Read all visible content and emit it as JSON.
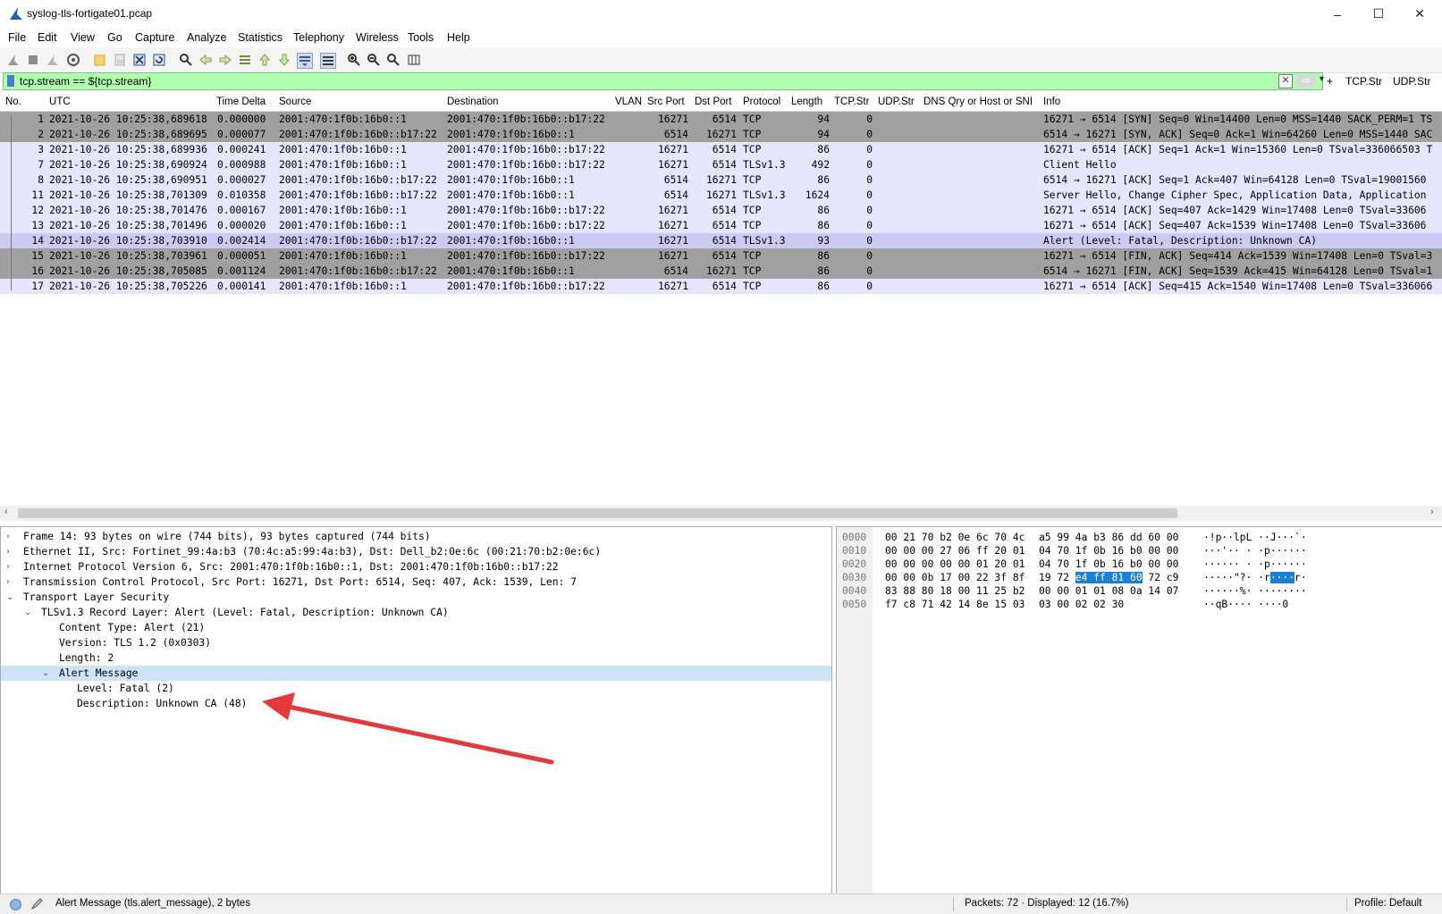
{
  "window": {
    "title": "syslog-tls-fortigate01.pcap",
    "controls": [
      "–",
      "☐",
      "✕"
    ]
  },
  "menu": [
    "File",
    "Edit",
    "View",
    "Go",
    "Capture",
    "Analyze",
    "Statistics",
    "Telephony",
    "Wireless",
    "Tools",
    "Help"
  ],
  "filter": {
    "value": "tcp.stream == ${tcp.stream}",
    "buttons": [
      "+",
      "TCP.Str",
      "UDP.Str"
    ]
  },
  "columns": [
    "No.",
    "UTC",
    "Time Delta",
    "Source",
    "Destination",
    "VLAN",
    "Src Port",
    "Dst Port",
    "Protocol",
    "Length",
    "TCP.Str",
    "UDP.Str",
    "DNS Qry or Host or SNI",
    "Info"
  ],
  "packets": [
    {
      "no": "1",
      "utc": "2021-10-26 10:25:38,689618",
      "delta": "0.000000",
      "src": "2001:470:1f0b:16b0::1",
      "dst": "2001:470:1f0b:16b0::b17:22",
      "sport": "16271",
      "dport": "6514",
      "proto": "TCP",
      "len": "94",
      "tcpstr": "0",
      "info": "16271 → 6514 [SYN] Seq=0 Win=14400 Len=0 MSS=1440 SACK_PERM=1 TS",
      "style": "dark"
    },
    {
      "no": "2",
      "utc": "2021-10-26 10:25:38,689695",
      "delta": "0.000077",
      "src": "2001:470:1f0b:16b0::b17:22",
      "dst": "2001:470:1f0b:16b0::1",
      "sport": "6514",
      "dport": "16271",
      "proto": "TCP",
      "len": "94",
      "tcpstr": "0",
      "info": "6514 → 16271 [SYN, ACK] Seq=0 Ack=1 Win=64260 Len=0 MSS=1440 SAC",
      "style": "dark"
    },
    {
      "no": "3",
      "utc": "2021-10-26 10:25:38,689936",
      "delta": "0.000241",
      "src": "2001:470:1f0b:16b0::1",
      "dst": "2001:470:1f0b:16b0::b17:22",
      "sport": "16271",
      "dport": "6514",
      "proto": "TCP",
      "len": "86",
      "tcpstr": "0",
      "info": "16271 → 6514 [ACK] Seq=1 Ack=1 Win=15360 Len=0 TSval=336066503 T",
      "style": "light"
    },
    {
      "no": "7",
      "utc": "2021-10-26 10:25:38,690924",
      "delta": "0.000988",
      "src": "2001:470:1f0b:16b0::1",
      "dst": "2001:470:1f0b:16b0::b17:22",
      "sport": "16271",
      "dport": "6514",
      "proto": "TLSv1.3",
      "len": "492",
      "tcpstr": "0",
      "info": "Client Hello",
      "style": "light"
    },
    {
      "no": "8",
      "utc": "2021-10-26 10:25:38,690951",
      "delta": "0.000027",
      "src": "2001:470:1f0b:16b0::b17:22",
      "dst": "2001:470:1f0b:16b0::1",
      "sport": "6514",
      "dport": "16271",
      "proto": "TCP",
      "len": "86",
      "tcpstr": "0",
      "info": "6514 → 16271 [ACK] Seq=1 Ack=407 Win=64128 Len=0 TSval=19001560",
      "style": "light"
    },
    {
      "no": "11",
      "utc": "2021-10-26 10:25:38,701309",
      "delta": "0.010358",
      "src": "2001:470:1f0b:16b0::b17:22",
      "dst": "2001:470:1f0b:16b0::1",
      "sport": "6514",
      "dport": "16271",
      "proto": "TLSv1.3",
      "len": "1624",
      "tcpstr": "0",
      "info": "Server Hello, Change Cipher Spec, Application Data, Application",
      "style": "light"
    },
    {
      "no": "12",
      "utc": "2021-10-26 10:25:38,701476",
      "delta": "0.000167",
      "src": "2001:470:1f0b:16b0::1",
      "dst": "2001:470:1f0b:16b0::b17:22",
      "sport": "16271",
      "dport": "6514",
      "proto": "TCP",
      "len": "86",
      "tcpstr": "0",
      "info": "16271 → 6514 [ACK] Seq=407 Ack=1429 Win=17408 Len=0 TSval=33606",
      "style": "light"
    },
    {
      "no": "13",
      "utc": "2021-10-26 10:25:38,701496",
      "delta": "0.000020",
      "src": "2001:470:1f0b:16b0::1",
      "dst": "2001:470:1f0b:16b0::b17:22",
      "sport": "16271",
      "dport": "6514",
      "proto": "TCP",
      "len": "86",
      "tcpstr": "0",
      "info": "16271 → 6514 [ACK] Seq=407 Ack=1539 Win=17408 Len=0 TSval=33606",
      "style": "light"
    },
    {
      "no": "14",
      "utc": "2021-10-26 10:25:38,703910",
      "delta": "0.002414",
      "src": "2001:470:1f0b:16b0::b17:22",
      "dst": "2001:470:1f0b:16b0::1",
      "sport": "16271",
      "dport": "6514",
      "proto": "TLSv1.3",
      "len": "93",
      "tcpstr": "0",
      "info": "Alert (Level: Fatal, Description: Unknown CA)",
      "style": "selected"
    },
    {
      "no": "15",
      "utc": "2021-10-26 10:25:38,703961",
      "delta": "0.000051",
      "src": "2001:470:1f0b:16b0::1",
      "dst": "2001:470:1f0b:16b0::b17:22",
      "sport": "16271",
      "dport": "6514",
      "proto": "TCP",
      "len": "86",
      "tcpstr": "0",
      "info": "16271 → 6514 [FIN, ACK] Seq=414 Ack=1539 Win=17408 Len=0 TSval=3",
      "style": "dark"
    },
    {
      "no": "16",
      "utc": "2021-10-26 10:25:38,705085",
      "delta": "0.001124",
      "src": "2001:470:1f0b:16b0::b17:22",
      "dst": "2001:470:1f0b:16b0::1",
      "sport": "6514",
      "dport": "16271",
      "proto": "TCP",
      "len": "86",
      "tcpstr": "0",
      "info": "6514 → 16271 [FIN, ACK] Seq=1539 Ack=415 Win=64128 Len=0 TSval=1",
      "style": "dark"
    },
    {
      "no": "17",
      "utc": "2021-10-26 10:25:38,705226",
      "delta": "0.000141",
      "src": "2001:470:1f0b:16b0::1",
      "dst": "2001:470:1f0b:16b0::b17:22",
      "sport": "16271",
      "dport": "6514",
      "proto": "TCP",
      "len": "86",
      "tcpstr": "0",
      "info": "16271 → 6514 [ACK] Seq=415 Ack=1540 Win=17408 Len=0 TSval=336066",
      "style": "light"
    }
  ],
  "details": [
    {
      "expander": "›",
      "indent": 0,
      "text": "Frame 14: 93 bytes on wire (744 bits), 93 bytes captured (744 bits)"
    },
    {
      "expander": "›",
      "indent": 0,
      "text": "Ethernet II, Src: Fortinet_99:4a:b3 (70:4c:a5:99:4a:b3), Dst: Dell_b2:0e:6c (00:21:70:b2:0e:6c)"
    },
    {
      "expander": "›",
      "indent": 0,
      "text": "Internet Protocol Version 6, Src: 2001:470:1f0b:16b0::1, Dst: 2001:470:1f0b:16b0::b17:22"
    },
    {
      "expander": "›",
      "indent": 0,
      "text": "Transmission Control Protocol, Src Port: 16271, Dst Port: 6514, Seq: 407, Ack: 1539, Len: 7"
    },
    {
      "expander": "⌄",
      "indent": 0,
      "text": "Transport Layer Security"
    },
    {
      "expander": "⌄",
      "indent": 1,
      "text": "TLSv1.3 Record Layer: Alert (Level: Fatal, Description: Unknown CA)"
    },
    {
      "expander": "",
      "indent": 2,
      "text": "Content Type: Alert (21)"
    },
    {
      "expander": "",
      "indent": 2,
      "text": "Version: TLS 1.2 (0x0303)"
    },
    {
      "expander": "",
      "indent": 2,
      "text": "Length: 2"
    },
    {
      "expander": "⌄",
      "indent": 2,
      "text": "Alert Message",
      "selected": true
    },
    {
      "expander": "",
      "indent": 3,
      "text": "Level: Fatal (2)"
    },
    {
      "expander": "",
      "indent": 3,
      "text": "Description: Unknown CA (48)"
    }
  ],
  "hex": [
    {
      "offset": "0000",
      "bytes1": "00 21 70 b2 0e 6c 70 4c",
      "bytes2": "a5 99 4a b3 86 dd 60 00",
      "ascii": "·!p··lpL ··J···`·"
    },
    {
      "offset": "0010",
      "bytes1": "00 00 00 27 06 ff 20 01",
      "bytes2": "04 70 1f 0b 16 b0 00 00",
      "ascii": "···'·· · ·p······"
    },
    {
      "offset": "0020",
      "bytes1": "00 00 00 00 00 01 20 01",
      "bytes2": "04 70 1f 0b 16 b0 00 00",
      "ascii": "······ · ·p······"
    },
    {
      "offset": "0030",
      "bytes1": "00 00 0b 17 00 22 3f 8f",
      "bytes2pre": "19 72 ",
      "bytes2hl": "e4 ff 81 60",
      "bytes2post": " 72 c9",
      "asciipre": "·····\"?· ·r",
      "asciihl": "····",
      "asciipost": "r·"
    },
    {
      "offset": "0040",
      "bytes1": "83 88 80 18 00 11 25 b2",
      "bytes2": "00 00 01 01 08 0a 14 07",
      "ascii": "······%· ········"
    },
    {
      "offset": "0050",
      "bytes1": "f7 c8 71 42 14 8e 15 03",
      "bytes2": "03 00 02 02 30",
      "ascii": "··qB···· ····0"
    }
  ],
  "status": {
    "field": "Alert Message (tls.alert_message), 2 bytes",
    "packets": "Packets: 72 · Displayed: 12 (16.7%)",
    "profile": "Profile: Default"
  },
  "colors": {
    "light_row": "#e7e6ff",
    "dark_row": "#a0a0a0",
    "selected_row": "#cbcaf2",
    "filter_ok": "#afffaf",
    "hex_highlight": "#1a7fd6",
    "annotation_arrow": "#e23a3a"
  }
}
